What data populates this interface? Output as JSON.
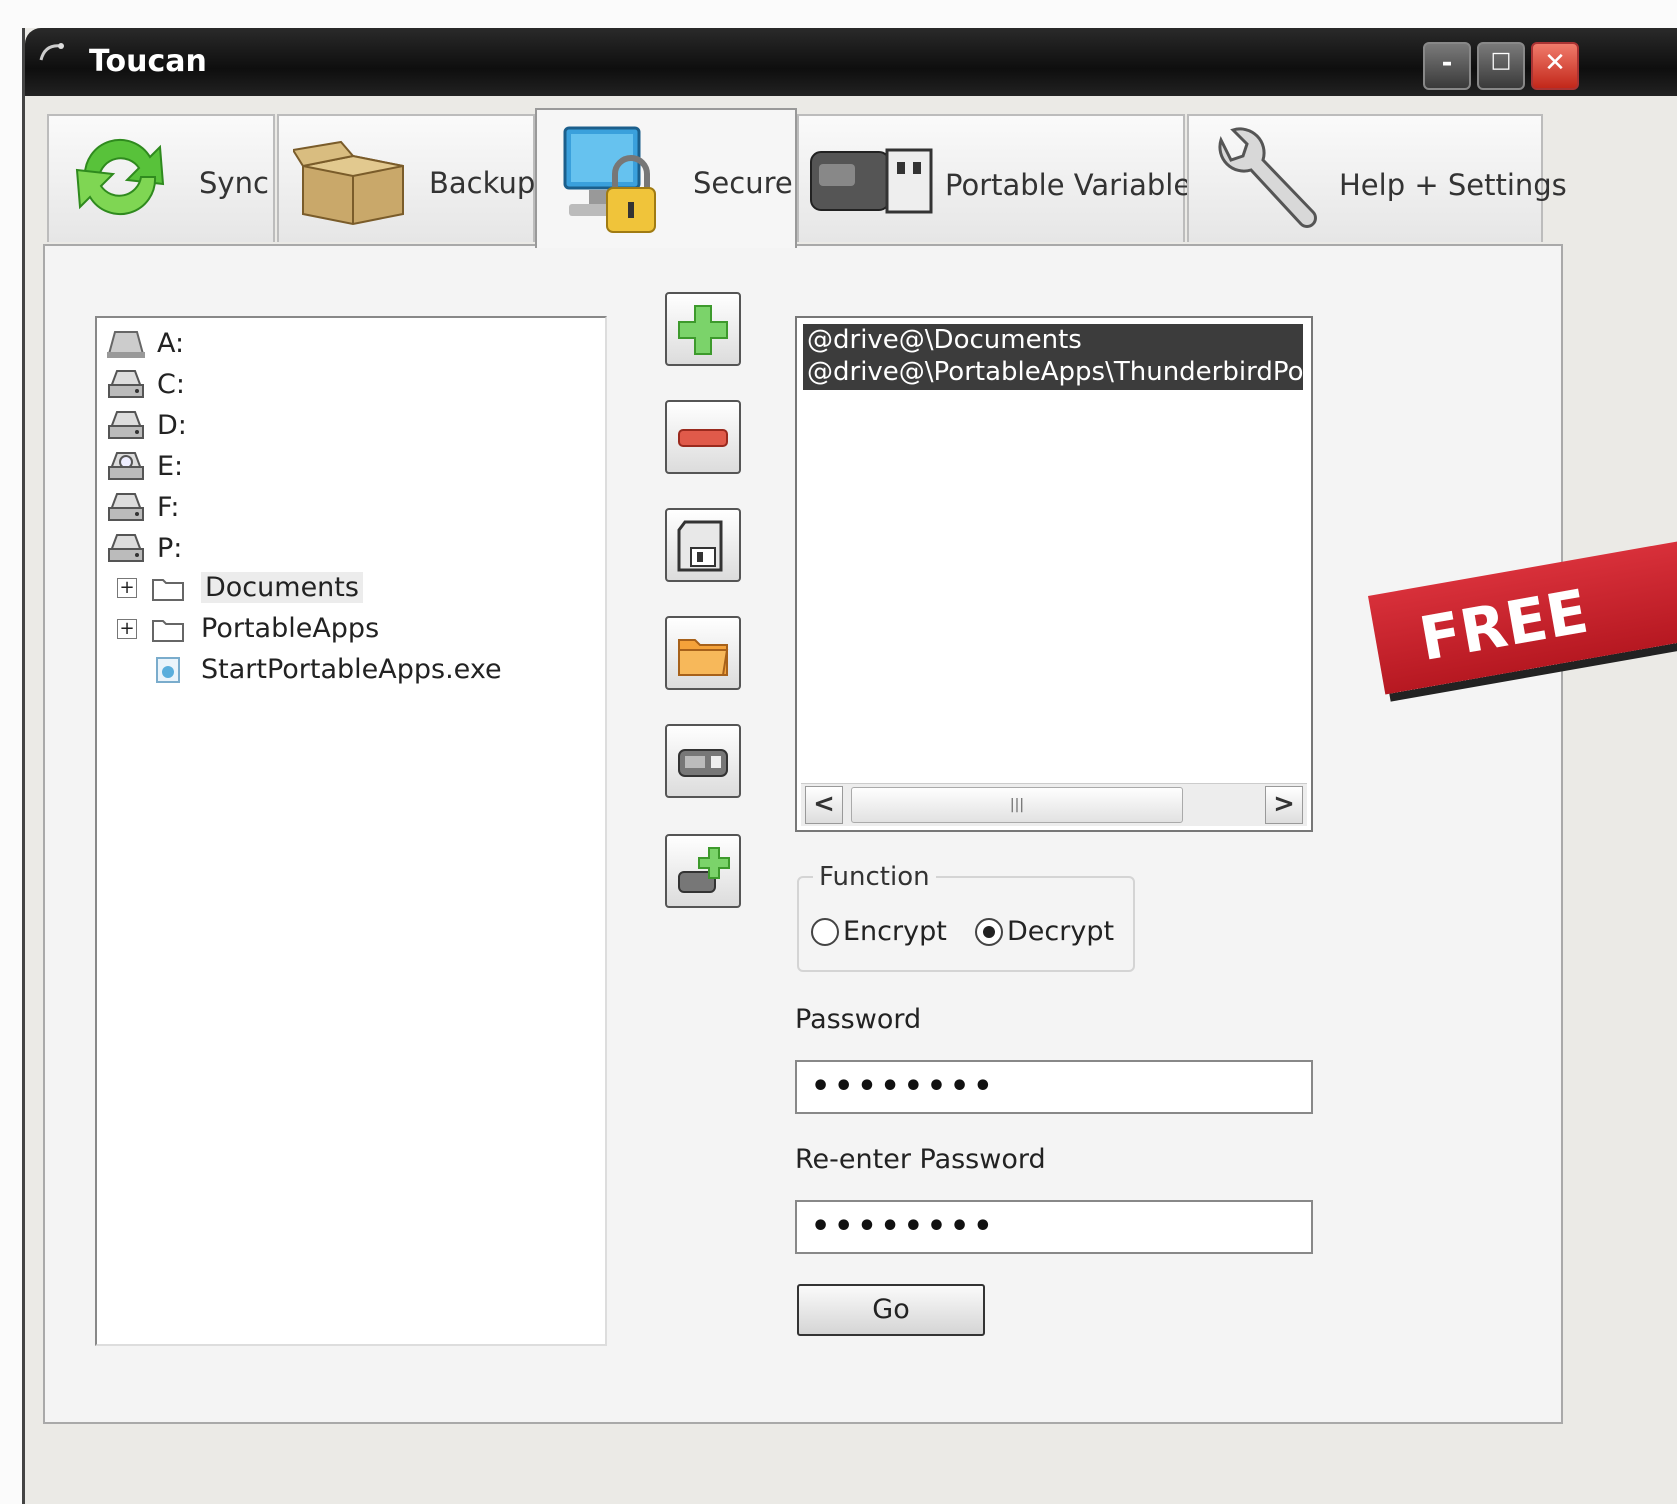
{
  "window": {
    "title": "Toucan",
    "controls": {
      "minimize": "-",
      "maximize": "□",
      "close": "✕"
    }
  },
  "tabs": [
    {
      "label": "Sync",
      "icon": "sync-icon"
    },
    {
      "label": "Backup",
      "icon": "box-icon"
    },
    {
      "label": "Secure",
      "icon": "computer-lock-icon",
      "active": true
    },
    {
      "label": "Portable Variables",
      "icon": "usb-drive-icon"
    },
    {
      "label": "Help + Settings",
      "icon": "wrench-icon"
    }
  ],
  "tree": {
    "drives": [
      "A:",
      "C:",
      "D:",
      "E:",
      "F:",
      "P:"
    ],
    "folders": [
      {
        "label": "Documents",
        "expander": "+"
      },
      {
        "label": "PortableApps",
        "expander": "+"
      }
    ],
    "file": {
      "label": "StartPortableApps.exe"
    }
  },
  "toolbar": [
    {
      "name": "add-icon"
    },
    {
      "name": "remove-icon"
    },
    {
      "name": "save-icon"
    },
    {
      "name": "open-folder-icon"
    },
    {
      "name": "drive-icon"
    },
    {
      "name": "add-drive-icon"
    }
  ],
  "list": {
    "items": [
      "@drive@\\Documents",
      "@drive@\\PortableApps\\ThunderbirdPortable"
    ],
    "scroll_left": "<",
    "scroll_right": ">",
    "thumb_grip": "|||"
  },
  "function": {
    "title": "Function",
    "options": [
      {
        "label": "Encrypt",
        "selected": false
      },
      {
        "label": "Decrypt",
        "selected": true
      }
    ]
  },
  "password": {
    "label": "Password",
    "value": "••••••••"
  },
  "reenter": {
    "label": "Re-enter Password",
    "value": "••••••••"
  },
  "go": {
    "label": "Go"
  },
  "badge": {
    "text": "FREE"
  },
  "colors": {
    "badge_red": "#c8232c",
    "selection": "#3c3c3c"
  }
}
